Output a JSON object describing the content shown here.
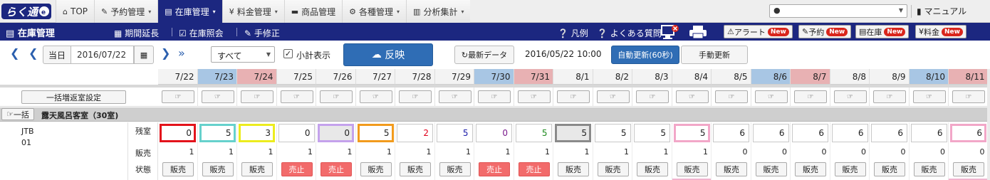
{
  "nav": {
    "logo_text": "らく通",
    "tabs": [
      {
        "label": "TOP",
        "icon": "home-icon",
        "active": false,
        "caret": false
      },
      {
        "label": "予約管理",
        "icon": "edit-icon",
        "active": false,
        "caret": true
      },
      {
        "label": "在庫管理",
        "icon": "list-icon",
        "active": true,
        "caret": true
      },
      {
        "label": "料金管理",
        "icon": "yen-icon",
        "active": false,
        "caret": true
      },
      {
        "label": "商品管理",
        "icon": "bed-icon",
        "active": false,
        "caret": false
      },
      {
        "label": "各種管理",
        "icon": "gear-icon",
        "active": false,
        "caret": true
      },
      {
        "label": "分析集計",
        "icon": "chart-icon",
        "active": false,
        "caret": true
      }
    ],
    "manual_label": "マニュアル"
  },
  "header": {
    "title": "在庫管理",
    "links": {
      "extend": "期間延長",
      "inquiry": "在庫照会",
      "manual_fix": "手修正",
      "legend": "凡例",
      "faq": "よくある質問"
    },
    "badges": {
      "alert": "アラート",
      "reservation": "予約",
      "stock": "在庫",
      "rate": "料金",
      "new": "New"
    },
    "accent": "#1c2780"
  },
  "toolbar": {
    "today_label": "当日",
    "date_value": "2016/07/22",
    "filter_value": "すべて",
    "subtotal_label": "小計表示",
    "subtotal_checked": true,
    "apply_label": "反映",
    "refresh_label": "最新データ",
    "last_updated": "2016/05/22 10:00",
    "auto_update_label": "自動更新(60秒)",
    "manual_update_label": "手動更新"
  },
  "grid": {
    "bulk_return_label": "一括増返室設定",
    "bulk_all_label": "一括",
    "room_name": "露天風呂客室（30室)",
    "agent_name": "JTB",
    "agent_code": "01",
    "row_labels": {
      "remain": "残室",
      "sold": "販売",
      "status": "状態"
    },
    "dates": [
      "7/22",
      "7/23",
      "7/24",
      "7/25",
      "7/26",
      "7/27",
      "7/28",
      "7/29",
      "7/30",
      "7/31",
      "8/1",
      "8/2",
      "8/3",
      "8/4",
      "8/5",
      "8/6",
      "8/7",
      "8/8",
      "8/9",
      "8/10",
      "8/11"
    ],
    "day_types": [
      "",
      "sat",
      "sun",
      "",
      "",
      "",
      "",
      "",
      "sat",
      "sun",
      "",
      "",
      "",
      "",
      "",
      "sat",
      "sun",
      "",
      "",
      "sat",
      "sun"
    ],
    "remain": [
      "0",
      "5",
      "3",
      "0",
      "0",
      "5",
      "2",
      "5",
      "0",
      "5",
      "5",
      "5",
      "5",
      "5",
      "6",
      "6",
      "6",
      "6",
      "6",
      "6",
      "6"
    ],
    "remain_text_colors": [
      "#222",
      "#222",
      "#222",
      "#222",
      "#222",
      "#222",
      "#e0001b",
      "#1a1aa8",
      "#7a1a8c",
      "#1d8a1d",
      "#222",
      "#222",
      "#222",
      "#222",
      "#222",
      "#222",
      "#222",
      "#222",
      "#222",
      "#222",
      "#222"
    ],
    "remain_border_colors": [
      "#e3131b",
      "#66d1cc",
      "#ecec1e",
      "#c8c8c8",
      "#c4a2ec",
      "#f29b1d",
      "#c8c8c8",
      "#c8c8c8",
      "#c8c8c8",
      "#c8c8c8",
      "#8a8a8a",
      "#c8c8c8",
      "#c8c8c8",
      "#f2a7c8",
      "#c8c8c8",
      "#c8c8c8",
      "#c8c8c8",
      "#c8c8c8",
      "#c8c8c8",
      "#c8c8c8",
      "#f2a7c8"
    ],
    "remain_bg_colors": [
      "#fff",
      "#fff",
      "#fff",
      "#fff",
      "#e8e8e8",
      "#fff",
      "#fff",
      "#fff",
      "#fff",
      "#fff",
      "#e8e8e8",
      "#fff",
      "#fff",
      "#fff",
      "#fff",
      "#fff",
      "#fff",
      "#fff",
      "#fff",
      "#fff",
      "#fff"
    ],
    "sold": [
      "1",
      "1",
      "1",
      "1",
      "1",
      "1",
      "1",
      "1",
      "1",
      "1",
      "1",
      "1",
      "1",
      "1",
      "0",
      "0",
      "0",
      "0",
      "0",
      "0",
      "0"
    ],
    "status": [
      "販売",
      "販売",
      "販売",
      "売止",
      "売止",
      "販売",
      "販売",
      "販売",
      "売止",
      "売止",
      "販売",
      "販売",
      "販売",
      "販売",
      "販売",
      "販売",
      "販売",
      "販売",
      "販売",
      "販売",
      "販売"
    ],
    "status_types": [
      "sell",
      "sell",
      "sell",
      "stop",
      "stop",
      "sell",
      "sell",
      "sell",
      "stop",
      "stop",
      "sell",
      "sell",
      "sell",
      "sell",
      "sell",
      "sell",
      "sell",
      "sell",
      "sell",
      "sell",
      "sell"
    ]
  }
}
